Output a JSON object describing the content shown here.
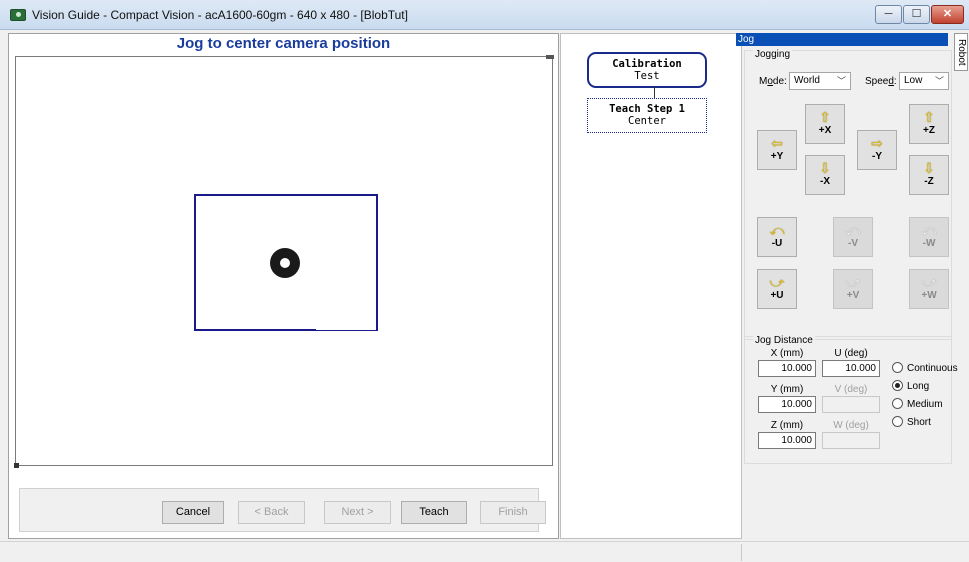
{
  "window": {
    "title": "Vision Guide - Compact Vision - acA1600-60gm - 640 x 480 - [BlobTut]",
    "min": "─",
    "max": "☐",
    "close": "✕"
  },
  "left": {
    "title": "Jog to center camera position",
    "buttons": {
      "cancel": "Cancel",
      "back": "< Back",
      "next": "Next >",
      "teach": "Teach",
      "finish": "Finish"
    }
  },
  "steps": [
    {
      "title": "Calibration",
      "sub": "Test"
    },
    {
      "title": "Teach Step 1",
      "sub": "Center"
    }
  ],
  "jog": {
    "tab": "Jog",
    "robot_tab": "Robot",
    "jogging_group": "Jogging",
    "mode_label": "Mode:",
    "mode_value": "World",
    "speed_label": "Speed:",
    "speed_value": "Low",
    "buttons": {
      "py": "+Y",
      "px": "+X",
      "nx": "-X",
      "ny": "-Y",
      "pz": "+Z",
      "nz": "-Z",
      "nu": "-U",
      "nv": "-V",
      "nw": "-W",
      "pu": "+U",
      "pv": "+V",
      "pw": "+W"
    },
    "distance_group": "Jog Distance",
    "x_label": "X (mm)",
    "x_value": "10.000",
    "u_label": "U (deg)",
    "u_value": "10.000",
    "y_label": "Y (mm)",
    "y_value": "10.000",
    "v_label": "V (deg)",
    "v_value": "",
    "z_label": "Z (mm)",
    "z_value": "10.000",
    "w_label": "W (deg)",
    "w_value": "",
    "radio_continuous": "Continuous",
    "radio_long": "Long",
    "radio_medium": "Medium",
    "radio_short": "Short",
    "selected_radio": "Long"
  }
}
